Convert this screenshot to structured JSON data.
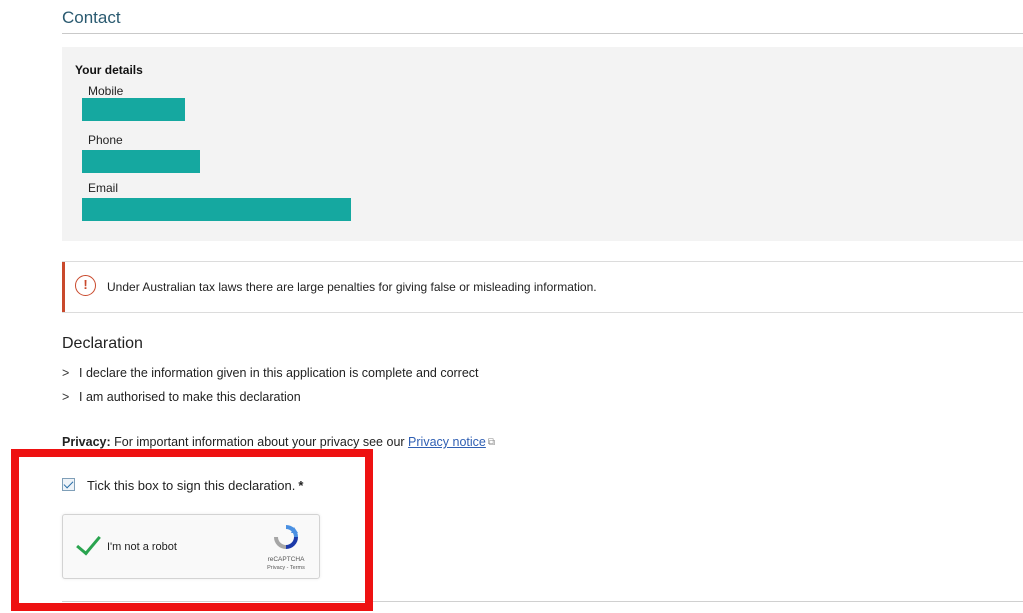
{
  "contact": {
    "title": "Contact",
    "details_heading": "Your details",
    "fields": [
      {
        "label": "Mobile",
        "value": ""
      },
      {
        "label": "Phone",
        "value": ""
      },
      {
        "label": "Email",
        "value": ""
      }
    ],
    "field_fill_color": "#15a8a0"
  },
  "warning": {
    "icon": "alert-circle-icon",
    "text": "Under Australian tax laws there are large penalties for giving false or misleading information.",
    "accent_color": "#c9492c"
  },
  "declaration": {
    "title": "Declaration",
    "items": [
      "I declare the information given in this application is complete and correct",
      "I am authorised to make this declaration"
    ]
  },
  "privacy": {
    "label": "Privacy:",
    "text": "For important information about your privacy see our",
    "link_text": "Privacy notice",
    "link_icon": "external-link-icon"
  },
  "sign": {
    "label": "Tick this box to sign this declaration.",
    "required_marker": "*",
    "checked": true
  },
  "recaptcha": {
    "label": "I'm not a robot",
    "brand": "reCAPTCHA",
    "terms": "Privacy - Terms",
    "verified": true
  },
  "highlight_color": "#ee1111"
}
